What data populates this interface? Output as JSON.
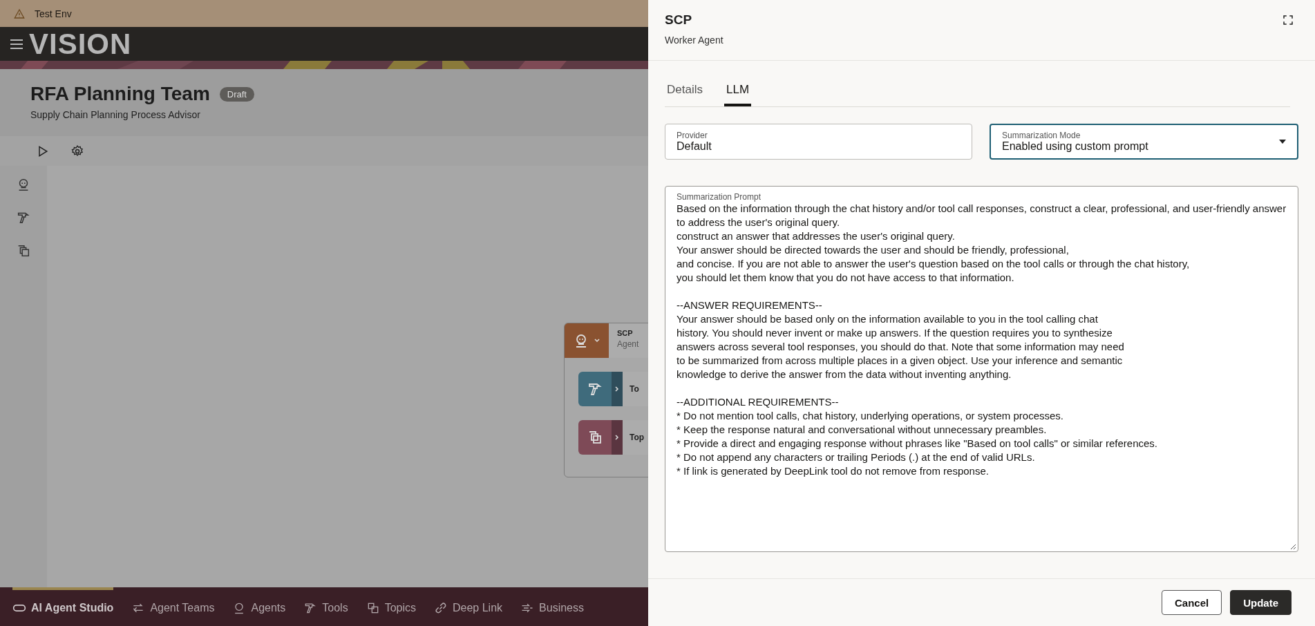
{
  "environment": {
    "label": "Test Env"
  },
  "app": {
    "logo": "VISION"
  },
  "team": {
    "title": "RFA Planning Team",
    "status": "Draft",
    "subtitle": "Supply Chain Planning Process Advisor"
  },
  "canvas": {
    "node": {
      "title": "SCP",
      "subtitle": "Agent",
      "children": [
        {
          "kind": "tools",
          "label": "To"
        },
        {
          "kind": "topics",
          "label": "Top"
        }
      ]
    }
  },
  "bottom_nav": [
    {
      "kind": "studio",
      "label": "AI Agent Studio",
      "selected": true
    },
    {
      "kind": "teams",
      "label": "Agent Teams",
      "selected": false
    },
    {
      "kind": "agents",
      "label": "Agents",
      "selected": false
    },
    {
      "kind": "tools",
      "label": "Tools",
      "selected": false
    },
    {
      "kind": "topics",
      "label": "Topics",
      "selected": false
    },
    {
      "kind": "link",
      "label": "Deep Link",
      "selected": false
    },
    {
      "kind": "business",
      "label": "Business",
      "selected": false
    }
  ],
  "drawer": {
    "title": "SCP",
    "subtitle": "Worker Agent",
    "tabs": [
      {
        "label": "Details",
        "selected": false
      },
      {
        "label": "LLM",
        "selected": true
      }
    ],
    "fields": [
      {
        "kind": "text",
        "label": "Provider",
        "value": "Default",
        "focused": false
      },
      {
        "kind": "select",
        "label": "Summarization Mode",
        "value": "Enabled using custom prompt",
        "focused": true
      }
    ],
    "prompt": {
      "label": "Summarization Prompt",
      "value": "Based on the information through the chat history and/or tool call responses, construct a clear, professional, and user-friendly answer to address the user's original query.\nconstruct an answer that addresses the user's original query.\nYour answer should be directed towards the user and should be friendly, professional,\nand concise. If you are not able to answer the user's question based on the tool calls or through the chat history,\nyou should let them know that you do not have access to that information.\n\n--ANSWER REQUIREMENTS--\nYour answer should be based only on the information available to you in the tool calling chat\nhistory. You should never invent or make up answers. If the question requires you to synthesize\nanswers across several tool responses, you should do that. Note that some information may need\nto be summarized from across multiple places in a given object. Use your inference and semantic\nknowledge to derive the answer from the data without inventing anything.\n\n--ADDITIONAL REQUIREMENTS--\n* Do not mention tool calls, chat history, underlying operations, or system processes.\n* Keep the response natural and conversational without unnecessary preambles.\n* Provide a direct and engaging response without phrases like \"Based on tool calls\" or similar references.\n* Do not append any characters or trailing Periods (.) at the end of valid URLs.\n* If link is generated by DeepLink tool do not remove from response."
    },
    "buttons": [
      {
        "kind": "secondary",
        "label": "Cancel"
      },
      {
        "kind": "primary",
        "label": "Update"
      }
    ]
  }
}
